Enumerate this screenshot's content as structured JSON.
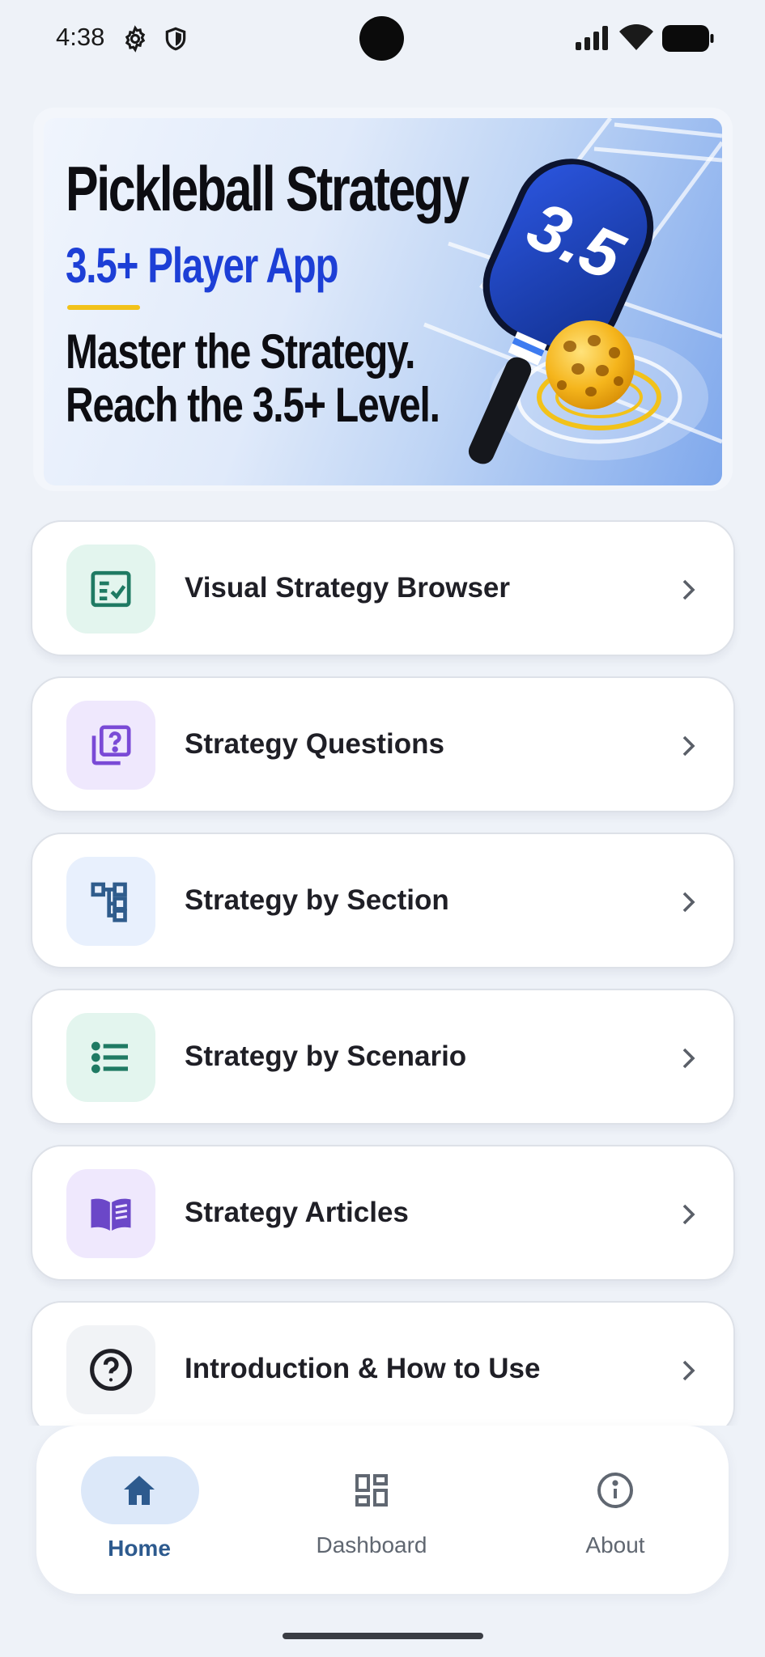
{
  "status_bar": {
    "time": "4:38",
    "icons": [
      "gear-icon",
      "shield-icon",
      "signal-icon",
      "wifi-icon",
      "battery-icon"
    ]
  },
  "banner": {
    "title": "Pickleball Strategy",
    "subtitle": "3.5+ Player App",
    "tagline_line1": "Master the Strategy.",
    "tagline_line2": "Reach the 3.5+ Level.",
    "paddle_text": "3.5",
    "colors": {
      "subtitle": "#1d3fd6",
      "underline": "#f2c21a",
      "paddle": "#1b3fbf",
      "ball": "#f5b51c"
    }
  },
  "menu": {
    "items": [
      {
        "label": "Visual Strategy Browser",
        "icon": "checklist-board-icon",
        "icon_bg": "#e3f5ee",
        "icon_color": "#1f7a63"
      },
      {
        "label": "Strategy Questions",
        "icon": "question-cards-icon",
        "icon_bg": "#efe8fd",
        "icon_color": "#7a4ad6"
      },
      {
        "label": "Strategy by Section",
        "icon": "hierarchy-icon",
        "icon_bg": "#e8f0fd",
        "icon_color": "#2f5c8c"
      },
      {
        "label": "Strategy by Scenario",
        "icon": "list-icon",
        "icon_bg": "#e3f5ee",
        "icon_color": "#1f7a63"
      },
      {
        "label": "Strategy Articles",
        "icon": "book-icon",
        "icon_bg": "#efe8fd",
        "icon_color": "#6b47c8"
      },
      {
        "label": "Introduction & How to Use",
        "icon": "help-circle-icon",
        "icon_bg": "#f1f3f6",
        "icon_color": "#1f1f26"
      }
    ]
  },
  "bottom_nav": {
    "active": "Home",
    "items": [
      {
        "label": "Home",
        "icon": "home-icon"
      },
      {
        "label": "Dashboard",
        "icon": "dashboard-icon"
      },
      {
        "label": "About",
        "icon": "info-icon"
      }
    ]
  }
}
